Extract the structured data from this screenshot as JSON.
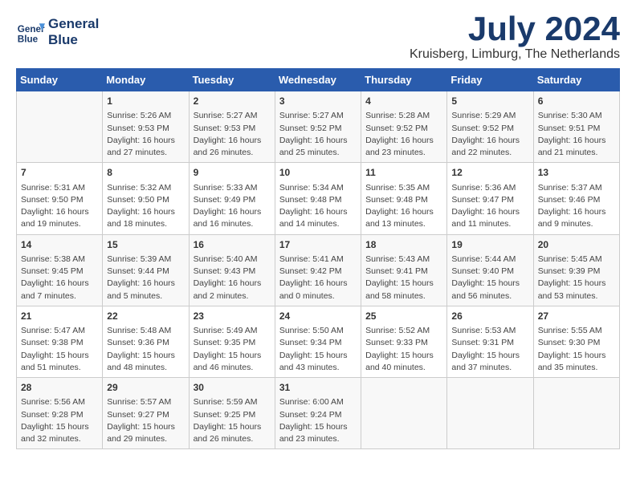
{
  "logo": {
    "text_line1": "General",
    "text_line2": "Blue"
  },
  "header": {
    "month_year": "July 2024",
    "location": "Kruisberg, Limburg, The Netherlands"
  },
  "days_of_week": [
    "Sunday",
    "Monday",
    "Tuesday",
    "Wednesday",
    "Thursday",
    "Friday",
    "Saturday"
  ],
  "weeks": [
    [
      {
        "day": "",
        "info": ""
      },
      {
        "day": "1",
        "info": "Sunrise: 5:26 AM\nSunset: 9:53 PM\nDaylight: 16 hours\nand 27 minutes."
      },
      {
        "day": "2",
        "info": "Sunrise: 5:27 AM\nSunset: 9:53 PM\nDaylight: 16 hours\nand 26 minutes."
      },
      {
        "day": "3",
        "info": "Sunrise: 5:27 AM\nSunset: 9:52 PM\nDaylight: 16 hours\nand 25 minutes."
      },
      {
        "day": "4",
        "info": "Sunrise: 5:28 AM\nSunset: 9:52 PM\nDaylight: 16 hours\nand 23 minutes."
      },
      {
        "day": "5",
        "info": "Sunrise: 5:29 AM\nSunset: 9:52 PM\nDaylight: 16 hours\nand 22 minutes."
      },
      {
        "day": "6",
        "info": "Sunrise: 5:30 AM\nSunset: 9:51 PM\nDaylight: 16 hours\nand 21 minutes."
      }
    ],
    [
      {
        "day": "7",
        "info": "Sunrise: 5:31 AM\nSunset: 9:50 PM\nDaylight: 16 hours\nand 19 minutes."
      },
      {
        "day": "8",
        "info": "Sunrise: 5:32 AM\nSunset: 9:50 PM\nDaylight: 16 hours\nand 18 minutes."
      },
      {
        "day": "9",
        "info": "Sunrise: 5:33 AM\nSunset: 9:49 PM\nDaylight: 16 hours\nand 16 minutes."
      },
      {
        "day": "10",
        "info": "Sunrise: 5:34 AM\nSunset: 9:48 PM\nDaylight: 16 hours\nand 14 minutes."
      },
      {
        "day": "11",
        "info": "Sunrise: 5:35 AM\nSunset: 9:48 PM\nDaylight: 16 hours\nand 13 minutes."
      },
      {
        "day": "12",
        "info": "Sunrise: 5:36 AM\nSunset: 9:47 PM\nDaylight: 16 hours\nand 11 minutes."
      },
      {
        "day": "13",
        "info": "Sunrise: 5:37 AM\nSunset: 9:46 PM\nDaylight: 16 hours\nand 9 minutes."
      }
    ],
    [
      {
        "day": "14",
        "info": "Sunrise: 5:38 AM\nSunset: 9:45 PM\nDaylight: 16 hours\nand 7 minutes."
      },
      {
        "day": "15",
        "info": "Sunrise: 5:39 AM\nSunset: 9:44 PM\nDaylight: 16 hours\nand 5 minutes."
      },
      {
        "day": "16",
        "info": "Sunrise: 5:40 AM\nSunset: 9:43 PM\nDaylight: 16 hours\nand 2 minutes."
      },
      {
        "day": "17",
        "info": "Sunrise: 5:41 AM\nSunset: 9:42 PM\nDaylight: 16 hours\nand 0 minutes."
      },
      {
        "day": "18",
        "info": "Sunrise: 5:43 AM\nSunset: 9:41 PM\nDaylight: 15 hours\nand 58 minutes."
      },
      {
        "day": "19",
        "info": "Sunrise: 5:44 AM\nSunset: 9:40 PM\nDaylight: 15 hours\nand 56 minutes."
      },
      {
        "day": "20",
        "info": "Sunrise: 5:45 AM\nSunset: 9:39 PM\nDaylight: 15 hours\nand 53 minutes."
      }
    ],
    [
      {
        "day": "21",
        "info": "Sunrise: 5:47 AM\nSunset: 9:38 PM\nDaylight: 15 hours\nand 51 minutes."
      },
      {
        "day": "22",
        "info": "Sunrise: 5:48 AM\nSunset: 9:36 PM\nDaylight: 15 hours\nand 48 minutes."
      },
      {
        "day": "23",
        "info": "Sunrise: 5:49 AM\nSunset: 9:35 PM\nDaylight: 15 hours\nand 46 minutes."
      },
      {
        "day": "24",
        "info": "Sunrise: 5:50 AM\nSunset: 9:34 PM\nDaylight: 15 hours\nand 43 minutes."
      },
      {
        "day": "25",
        "info": "Sunrise: 5:52 AM\nSunset: 9:33 PM\nDaylight: 15 hours\nand 40 minutes."
      },
      {
        "day": "26",
        "info": "Sunrise: 5:53 AM\nSunset: 9:31 PM\nDaylight: 15 hours\nand 37 minutes."
      },
      {
        "day": "27",
        "info": "Sunrise: 5:55 AM\nSunset: 9:30 PM\nDaylight: 15 hours\nand 35 minutes."
      }
    ],
    [
      {
        "day": "28",
        "info": "Sunrise: 5:56 AM\nSunset: 9:28 PM\nDaylight: 15 hours\nand 32 minutes."
      },
      {
        "day": "29",
        "info": "Sunrise: 5:57 AM\nSunset: 9:27 PM\nDaylight: 15 hours\nand 29 minutes."
      },
      {
        "day": "30",
        "info": "Sunrise: 5:59 AM\nSunset: 9:25 PM\nDaylight: 15 hours\nand 26 minutes."
      },
      {
        "day": "31",
        "info": "Sunrise: 6:00 AM\nSunset: 9:24 PM\nDaylight: 15 hours\nand 23 minutes."
      },
      {
        "day": "",
        "info": ""
      },
      {
        "day": "",
        "info": ""
      },
      {
        "day": "",
        "info": ""
      }
    ]
  ]
}
